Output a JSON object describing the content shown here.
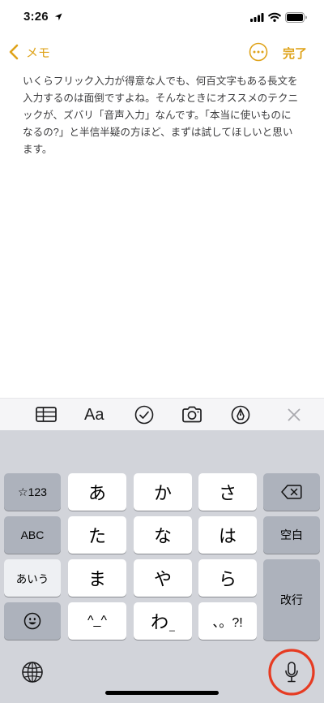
{
  "status_bar": {
    "time": "3:26",
    "icons": [
      "location-arrow-icon",
      "cellular-signal-icon",
      "wifi-icon",
      "battery-icon"
    ]
  },
  "nav_bar": {
    "back_label": "メモ",
    "done_label": "完了",
    "icons": [
      "chevron-left-icon",
      "more-circle-icon"
    ]
  },
  "note": {
    "body": "いくらフリック入力が得意な人でも、何百文字もある長文を入力するのは面倒ですよね。そんなときにオススメのテクニックが、ズバリ「音声入力」なんです。「本当に使いものになるの?」と半信半疑の方ほど、まずは試してほしいと思います。"
  },
  "toolbar": {
    "format_label": "Aa",
    "icons": [
      "table-icon",
      "checklist-icon",
      "camera-icon",
      "markup-icon",
      "close-icon"
    ]
  },
  "keyboard": {
    "keys": {
      "numbers": "☆123",
      "a": "あ",
      "ka": "か",
      "sa": "さ",
      "abc": "ABC",
      "ta": "た",
      "na": "な",
      "ha": "は",
      "space": "空白",
      "kana": "あいう",
      "ma": "ま",
      "ya": "や",
      "ra": "ら",
      "return": "改行",
      "kaomoji": "^_^",
      "wa": "わ",
      "wa_hint": "_",
      "punctuation": "、。?!"
    },
    "icons": [
      "delete-icon",
      "emoji-icon",
      "globe-icon",
      "microphone-icon"
    ]
  },
  "colors": {
    "accent": "#dfa31a",
    "annotation_ring": "#e63b22",
    "keyboard_bg": "#d2d4da"
  }
}
